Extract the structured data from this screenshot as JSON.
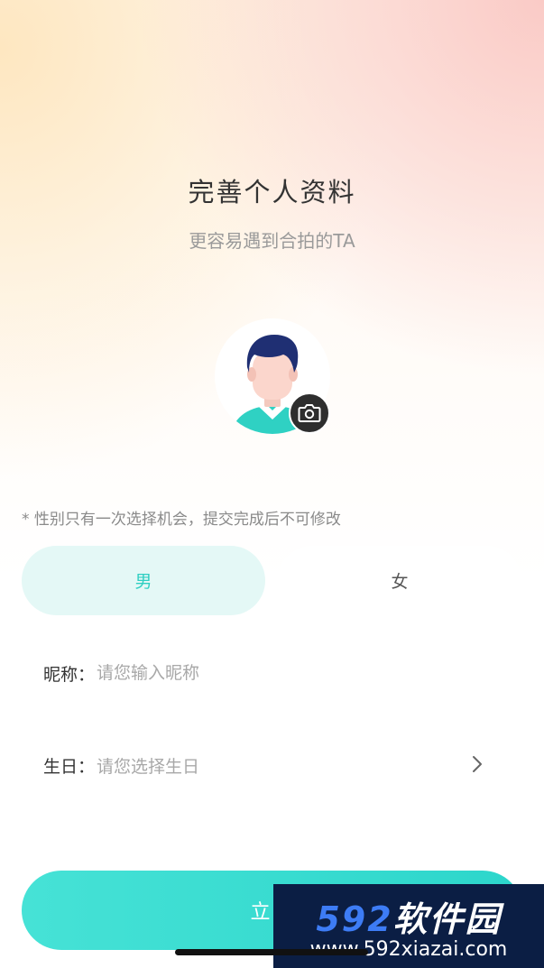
{
  "header": {
    "title": "完善个人资料",
    "subtitle": "更容易遇到合拍的TA"
  },
  "avatar": {
    "icon": "default-male-avatar-icon",
    "camera_icon": "camera-icon"
  },
  "notice": "* 性别只有一次选择机会，提交完成后不可修改",
  "gender": {
    "male_label": "男",
    "female_label": "女",
    "selected": "男"
  },
  "nickname": {
    "label": "昵称：",
    "placeholder": "请您输入昵称",
    "value": ""
  },
  "birthday": {
    "label": "生日：",
    "placeholder": "请您选择生日",
    "icon": "chevron-right-icon"
  },
  "submit": {
    "label": "立即"
  },
  "watermark": {
    "brand_number": "592",
    "brand_text": "软件园",
    "url": "www.592xiazai.com"
  },
  "colors": {
    "accent": "#2fcfc2",
    "selected_bg": "#e4f8f6",
    "button_gradient_start": "#46e2d6",
    "button_gradient_end": "#2cd6cb"
  }
}
